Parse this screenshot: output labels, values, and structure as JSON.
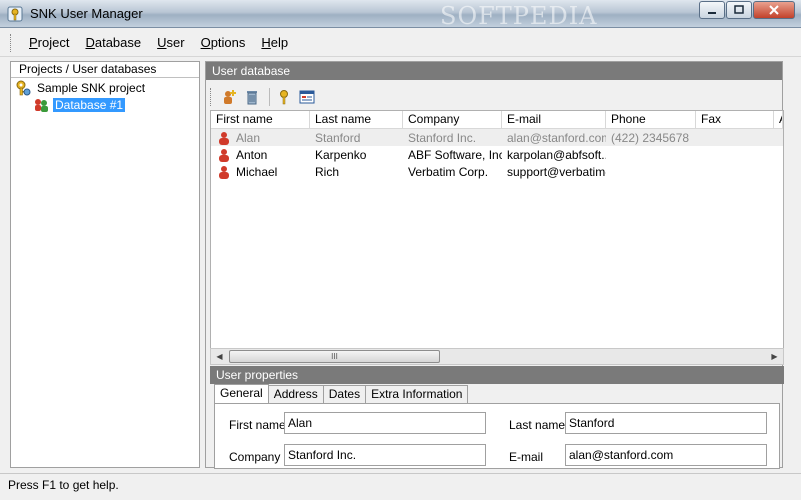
{
  "window": {
    "title": "SNK User Manager",
    "watermark": "SOFTPEDIA",
    "minimize_icon": "minimize-icon",
    "maximize_icon": "maximize-icon",
    "close_icon": "close-icon"
  },
  "menu": {
    "items": [
      {
        "label": "Project",
        "mnemonic": "P",
        "rest": "roject"
      },
      {
        "label": "Database",
        "mnemonic": "D",
        "rest": "atabase"
      },
      {
        "label": "User",
        "mnemonic": "U",
        "rest": "ser"
      },
      {
        "label": "Options",
        "mnemonic": "O",
        "rest": "ptions"
      },
      {
        "label": "Help",
        "mnemonic": "H",
        "rest": "elp"
      }
    ]
  },
  "tree": {
    "header": "Projects / User databases",
    "project_label": "Sample SNK project",
    "project_icon": "key-project-icon",
    "database_label": "Database #1",
    "database_icon": "users-database-icon"
  },
  "user_database": {
    "title": "User database",
    "toolbar": [
      "add-user-icon",
      "delete-icon",
      "key-icon",
      "properties-icon"
    ],
    "columns": [
      "First name",
      "Last name",
      "Company",
      "E-mail",
      "Phone",
      "Fax",
      "A"
    ],
    "rows": [
      {
        "first": "Alan",
        "last": "Stanford",
        "company": "Stanford Inc.",
        "email": "alan@stanford.com",
        "phone": "(422) 2345678",
        "fax": ""
      },
      {
        "first": "Anton",
        "last": "Karpenko",
        "company": "ABF Software, Inc.",
        "email": "karpolan@abfsoft...",
        "phone": "",
        "fax": ""
      },
      {
        "first": "Michael",
        "last": "Rich",
        "company": "Verbatim Corp.",
        "email": "support@verbatim-...",
        "phone": "",
        "fax": ""
      }
    ],
    "scroll_grip": "III"
  },
  "user_properties": {
    "title": "User properties",
    "tabs": [
      "General",
      "Address",
      "Dates",
      "Extra Information"
    ],
    "active_tab": "General",
    "first_name_label": "First name",
    "first_name_value": "Alan",
    "last_name_label": "Last name",
    "last_name_value": "Stanford",
    "company_label": "Company",
    "company_value": "Stanford Inc.",
    "email_label": "E-mail",
    "email_value": "alan@stanford.com"
  },
  "status": {
    "text": "Press F1 to get help."
  },
  "colors": {
    "section_header": "#7a7a7a",
    "selection": "#3399ff",
    "user_icon": "#d03a2a"
  }
}
